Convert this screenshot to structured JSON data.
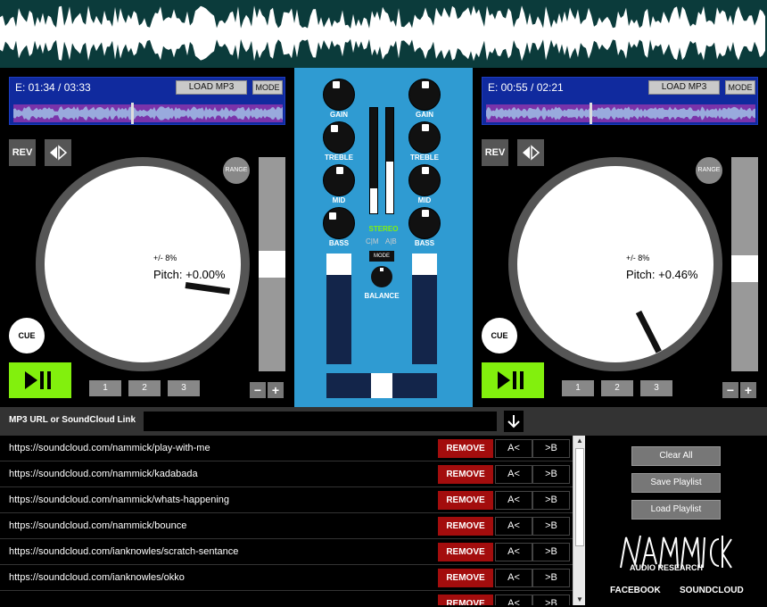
{
  "deck_left": {
    "time": "E: 01:34 / 03:33",
    "load_label": "LOAD MP3",
    "mode_label": "MODE",
    "rev_label": "REV",
    "range_label": "RANGE",
    "pitch_range": "+/- 8%",
    "pitch_text": "Pitch: +0.00%",
    "cue_label": "CUE",
    "hotcues": [
      "1",
      "2",
      "3"
    ],
    "progress": 0.45
  },
  "deck_right": {
    "time": "E: 00:55 / 02:21",
    "load_label": "LOAD MP3",
    "mode_label": "MODE",
    "rev_label": "REV",
    "range_label": "RANGE",
    "pitch_range": "+/- 8%",
    "pitch_text": "Pitch: +0.46%",
    "cue_label": "CUE",
    "hotcues": [
      "1",
      "2",
      "3"
    ],
    "progress": 0.4
  },
  "mixer": {
    "gain": "GAIN",
    "treble": "TREBLE",
    "mid": "MID",
    "bass": "BASS",
    "stereo": "STEREO",
    "cm": "C|M",
    "ab": "A|B",
    "mode": "MODE",
    "balance": "BALANCE"
  },
  "url_bar": {
    "label": "MP3 URL or SoundCloud Link",
    "value": ""
  },
  "playlist": {
    "remove_label": "REMOVE",
    "a_label": "A<",
    "b_label": ">B",
    "items": [
      "https://soundcloud.com/nammick/play-with-me",
      "https://soundcloud.com/nammick/kadabada",
      "https://soundcloud.com/nammick/whats-happening",
      "https://soundcloud.com/nammick/bounce",
      "https://soundcloud.com/ianknowles/scratch-sentance",
      "https://soundcloud.com/ianknowles/okko"
    ]
  },
  "side": {
    "clear_all": "Clear All",
    "save_playlist": "Save Playlist",
    "load_playlist": "Load Playlist",
    "logo_sub": "AUDIO RESEARCH",
    "facebook": "FACEBOOK",
    "soundcloud": "SOUNDCLOUD"
  },
  "colors": {
    "play_green": "#82f00d",
    "mixer_blue": "#2f9bd2",
    "info_blue": "#102a9e",
    "remove_red": "#a30d0d"
  }
}
